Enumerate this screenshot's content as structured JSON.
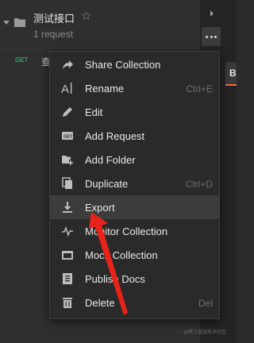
{
  "collection": {
    "title": "测试接口",
    "subtitle": "1 request"
  },
  "request": {
    "method": "GET",
    "name": "查"
  },
  "side_tab": {
    "label": "B"
  },
  "menu": {
    "items": [
      {
        "label": "Share Collection",
        "icon": "share-icon",
        "shortcut": ""
      },
      {
        "label": "Rename",
        "icon": "rename-icon",
        "shortcut": "Ctrl+E"
      },
      {
        "label": "Edit",
        "icon": "pencil-icon",
        "shortcut": ""
      },
      {
        "label": "Add Request",
        "icon": "add-request-icon",
        "shortcut": ""
      },
      {
        "label": "Add Folder",
        "icon": "add-folder-icon",
        "shortcut": ""
      },
      {
        "label": "Duplicate",
        "icon": "duplicate-icon",
        "shortcut": "Ctrl+D"
      },
      {
        "label": "Export",
        "icon": "download-icon",
        "shortcut": ""
      },
      {
        "label": "Monitor Collection",
        "icon": "monitor-icon",
        "shortcut": ""
      },
      {
        "label": "Mock Collection",
        "icon": "mock-icon",
        "shortcut": ""
      },
      {
        "label": "Publish Docs",
        "icon": "docs-icon",
        "shortcut": ""
      },
      {
        "label": "Delete",
        "icon": "trash-icon",
        "shortcut": "Del"
      }
    ],
    "hovered": "Export"
  },
  "colors": {
    "accent": "#f26b3a",
    "get_method": "#2fa46a",
    "annotation_arrow": "#e8231a"
  }
}
